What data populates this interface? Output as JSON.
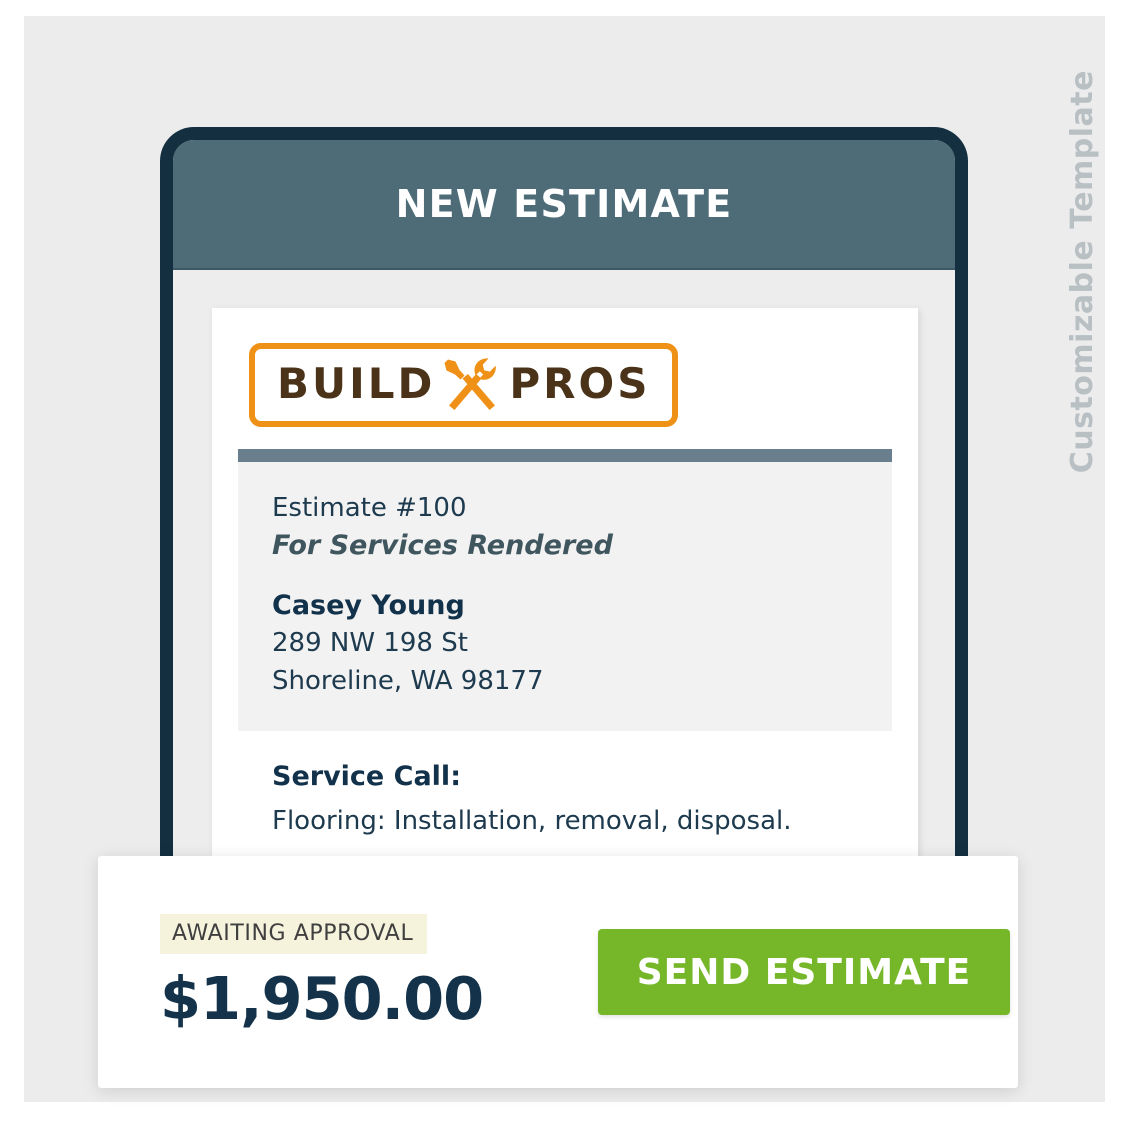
{
  "side_label": {
    "text": "Customizable Template"
  },
  "device": {
    "header_title": "NEW ESTIMATE"
  },
  "document": {
    "logo": {
      "word_left": "BUILD",
      "word_right": "PROS",
      "icon": "wrench-screwdriver-icon",
      "border_color": "#ef9116",
      "text_color": "#4a3318"
    },
    "estimate_number": "Estimate #100",
    "estimate_subtitle": "For Services Rendered",
    "customer_name": "Casey Young",
    "customer_address_line1": "289 NW 198 St",
    "customer_address_line2": "Shoreline, WA 98177",
    "service_label": "Service Call:",
    "service_description": "Flooring: Installation, removal, disposal."
  },
  "action_bar": {
    "status_badge": "AWAITING APPROVAL",
    "status_badge_bg": "#f6f3dd",
    "amount": "$1,950.00",
    "send_button": "SEND ESTIMATE",
    "send_button_color": "#76b72a"
  },
  "colors": {
    "page_bg": "#ffffff",
    "panel_bg": "#ececec",
    "device_frame": "#132f40",
    "device_header": "#4e6b78",
    "doc_rule": "#697f8d",
    "navy_text": "#14334a"
  }
}
